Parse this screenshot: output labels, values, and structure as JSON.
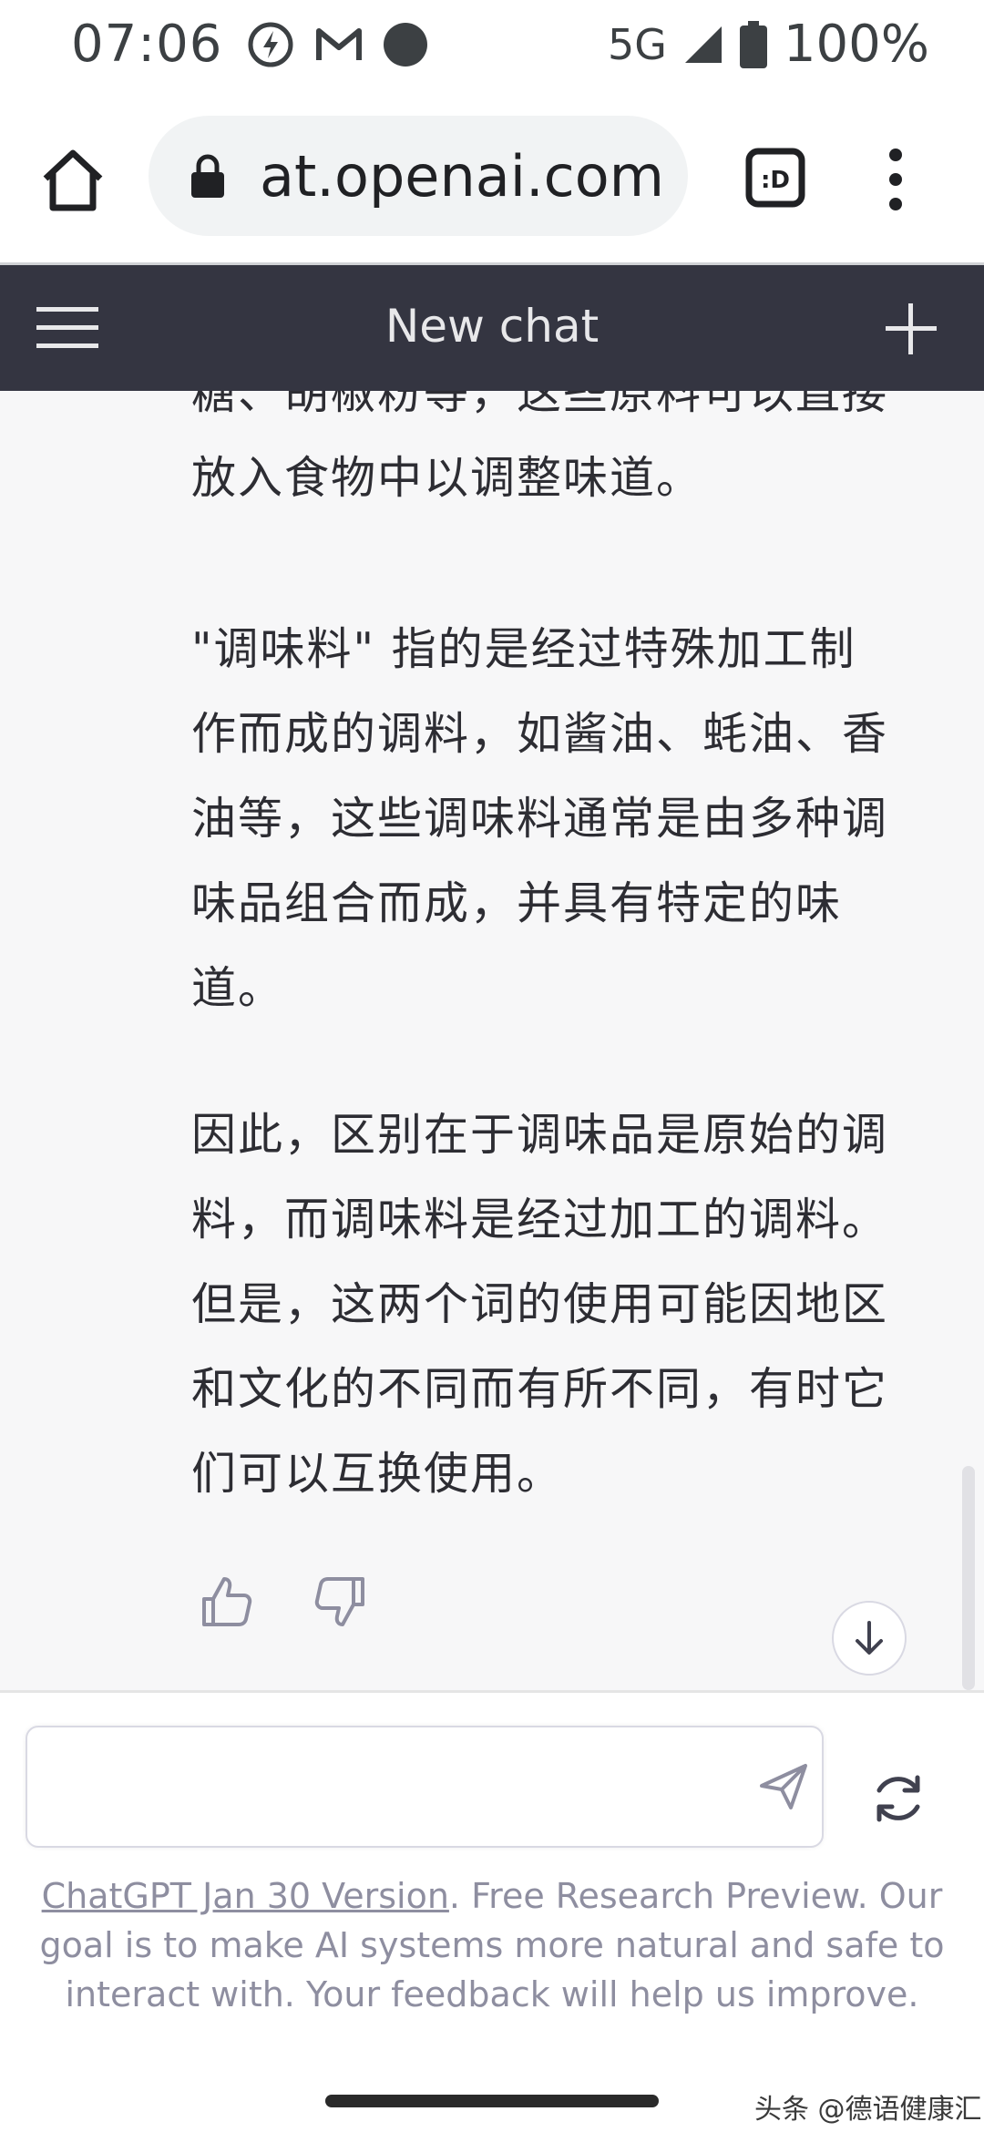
{
  "status_bar": {
    "time": "07:06",
    "network": "5G",
    "battery": "100%",
    "icons": [
      "data-saver-icon",
      "gmail-icon",
      "circle-notification-icon",
      "signal-icon",
      "battery-icon"
    ]
  },
  "browser": {
    "url": "at.openai.com",
    "tabs_label": ":D",
    "icons": [
      "home-icon",
      "lock-icon",
      "tabs-icon",
      "more-vert-icon"
    ]
  },
  "chat_header": {
    "title": "New chat",
    "icons": [
      "menu-icon",
      "plus-icon"
    ]
  },
  "messages": {
    "paragraphs": [
      "糖、胡椒粉等，这些原料可以直接放入食物中以调整味道。",
      "\"调味料\" 指的是经过特殊加工制作而成的调料，如酱油、蚝油、香油等，这些调味料通常是由多种调味品组合而成，并具有特定的味道。",
      "因此，区别在于调味品是原始的调料，而调味料是经过加工的调料。但是，这两个词的使用可能因地区和文化的不同而有所不同，有时它们可以互换使用。"
    ],
    "icons": [
      "thumbs-up-icon",
      "thumbs-down-icon",
      "arrow-down-icon"
    ]
  },
  "input": {
    "value": "",
    "placeholder": "",
    "icons": [
      "send-icon",
      "regenerate-icon"
    ]
  },
  "footer": {
    "link_text": "ChatGPT Jan 30 Version",
    "rest_text": ". Free Research Preview. Our goal is to make AI systems more natural and safe to interact with. Your feedback will help us improve."
  },
  "watermark": "头条 @德语健康汇",
  "colors": {
    "header_bg": "#343541",
    "message_bg": "#f7f7f8",
    "footer_text": "#8e8ea0"
  }
}
